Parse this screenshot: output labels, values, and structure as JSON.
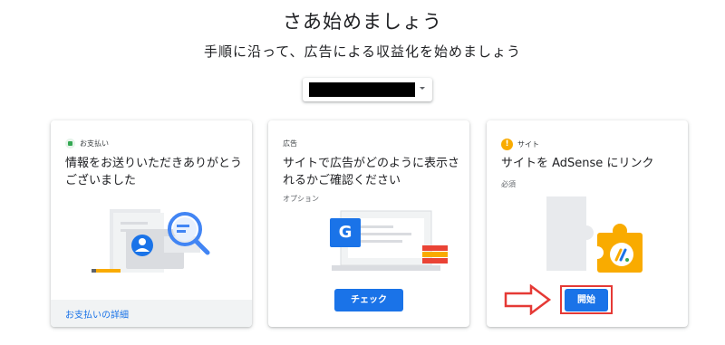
{
  "header": {
    "title": "さあ始めましょう",
    "subtitle": "手順に沿って、広告による収益化を始めましょう"
  },
  "site_selector": {
    "value_redacted": true
  },
  "cards": [
    {
      "kicker": "お支払い",
      "title": "情報をお送りいただきありがとうございました",
      "link": "お支払いの詳細",
      "status": "complete"
    },
    {
      "kicker": "広告",
      "title": "サイトで広告がどのように表示されるかご確認ください",
      "note": "オプション",
      "button": "チェック",
      "illustration_letter": "G"
    },
    {
      "kicker": "サイト",
      "title": "サイトを AdSense にリンク",
      "note": "必須",
      "button": "開始",
      "status": "warning",
      "status_glyph": "!"
    }
  ],
  "colors": {
    "primary": "#1a73e8",
    "success": "#34a853",
    "warning": "#f9ab00",
    "highlight_annotation": "#e53935"
  }
}
